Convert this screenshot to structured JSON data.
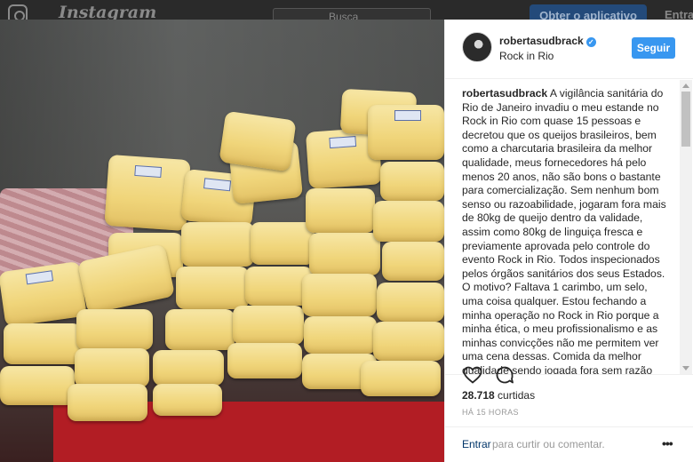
{
  "background_header": {
    "brand": "Instagram",
    "search_placeholder": "Busca",
    "get_app_label": "Obter o aplicativo",
    "login_label": "Entrar"
  },
  "post": {
    "username": "robertasudbrack",
    "verified": true,
    "location": "Rock in Rio",
    "follow_label": "Seguir",
    "caption_text": "A vigilância sanitária do Rio de Janeiro invadiu o meu estande no Rock in Rio com quase 15 pessoas e decretou que os queijos brasileiros, bem como a charcutaria brasileira da melhor qualidade, meus fornecedores há pelo menos 20 anos, não são bons o bastante para comercialização. Sem nenhum bom senso ou razoabilidade, jogaram fora mais de 80kg de queijo dentro da validade, assim como 80kg de linguiça fresca e previamente aprovada pelo controle do evento Rock in Rio. Todos inspecionados pelos órgãos sanitários dos seus Estados. O motivo? Faltava 1 carimbo, um selo, uma coisa qualquer. Estou fechando a minha operação no Rock in Rio porque a minha ética, o meu profissionalismo e as minhas convicções não me permitem ver uma cena dessas. Comida da melhor qualidade sendo jogada fora sem razão alguma.",
    "likes_count": "28.718",
    "likes_label": "curtidas",
    "time_ago": "HÁ 15 HORAS",
    "login_link": "Entrar",
    "login_prompt": "para curtir ou comentar.",
    "colors": {
      "accent": "#3897f0",
      "text": "#262626",
      "muted": "#999999",
      "link": "#003569"
    },
    "icons": [
      "heart-icon",
      "comment-icon",
      "more-options-icon",
      "verified-badge-icon"
    ]
  }
}
